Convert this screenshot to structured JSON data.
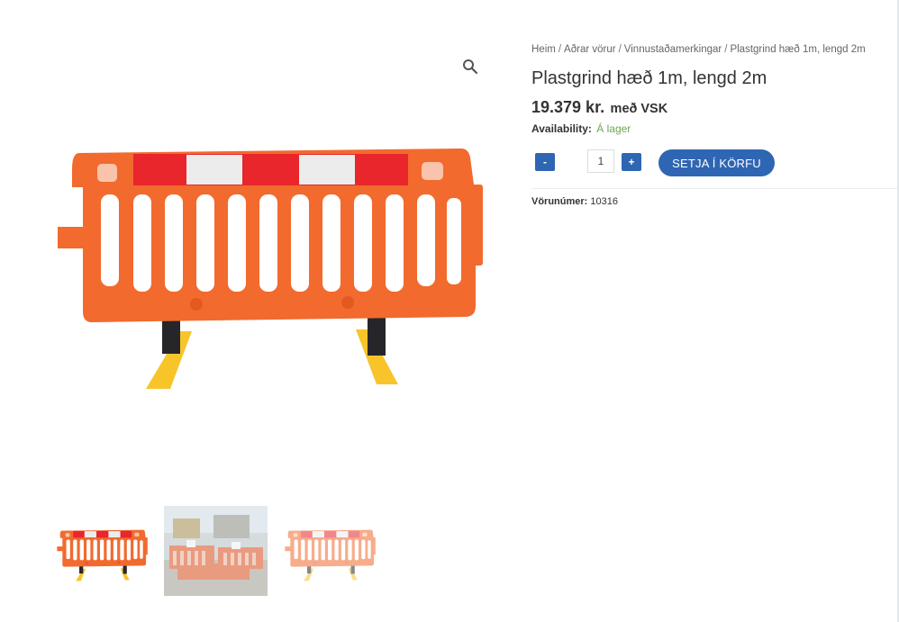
{
  "breadcrumb": {
    "items": [
      "Heim",
      "Aðrar vörur",
      "Vinnustaðamerkingar",
      "Plastgrind hæð 1m, lengd 2m"
    ],
    "separator": "/"
  },
  "product": {
    "title": "Plastgrind hæð 1m, lengd 2m",
    "price": "19.379 kr.",
    "price_suffix": "með VSK",
    "availability_label": "Availability:",
    "availability_value": "Á lager",
    "quantity": "1",
    "minus_label": "-",
    "plus_label": "+",
    "add_to_cart_label": "SETJA Í KÖRFU",
    "sku_label": "Vörunúmer:",
    "sku_value": "10316"
  },
  "gallery": {
    "zoom_icon": "search-icon",
    "thumbnails": [
      "barrier-thumbnail",
      "site-photo-thumbnail",
      "barrier-faded-thumbnail"
    ]
  },
  "colors": {
    "accent": "#2f66b3",
    "in_stock": "#6aa84f",
    "barrier_orange": "#f26a2e",
    "reflective_red": "#e8262b",
    "foot_yellow": "#f7c52a"
  }
}
